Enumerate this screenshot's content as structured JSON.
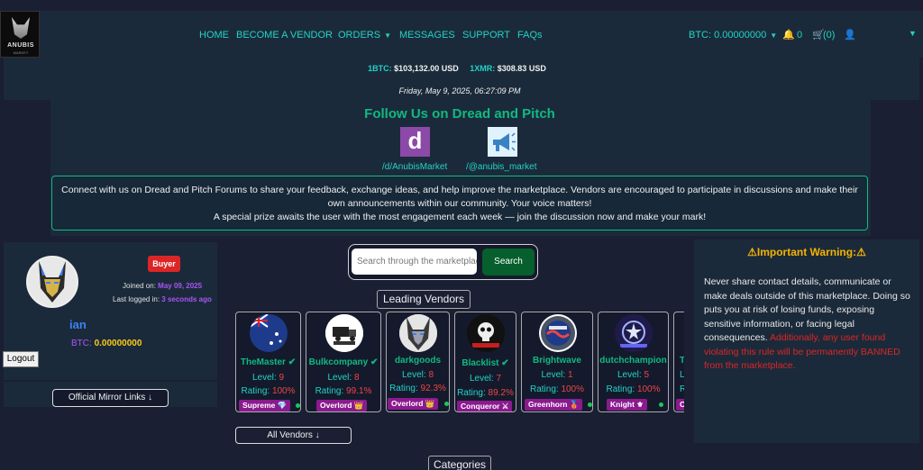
{
  "header": {
    "logo_text": "ANUBIS",
    "logo_subtext": "MARKET",
    "nav": [
      {
        "label": "HOME"
      },
      {
        "label": "BECOME A VENDOR"
      },
      {
        "label": "ORDERS"
      },
      {
        "label": "MESSAGES"
      },
      {
        "label": "SUPPORT"
      },
      {
        "label": "FAQs"
      }
    ],
    "balance": "BTC: 0.00000000",
    "notifications_count": "0",
    "cart_count": "(0)"
  },
  "rates": {
    "btc_label": "1BTC:",
    "btc_value": "$103,132.00 USD",
    "xmr_label": "1XMR:",
    "xmr_value": "$308.83 USD"
  },
  "datetime": "Friday, May 9, 2025, 06:27:09 PM",
  "follow": {
    "title": "Follow Us on Dread and Pitch",
    "dread_link": "/d/AnubisMarket",
    "pitch_link": "/@anubis_market",
    "announcement": [
      "Connect with us on Dread and Pitch Forums to share your feedback, exchange ideas, and help improve the marketplace. Vendors are encouraged to participate in discussions and make their",
      "own announcements within our community. Your voice matters!",
      "A special prize awaits the user with the most engagement each week — join the discussion now and make your mark!"
    ]
  },
  "profile": {
    "role_badge": "Buyer",
    "joined_label": "Joined on:",
    "joined_value": "May 09, 2025",
    "last_login_label": "Last logged in:",
    "last_login_value": "3 seconds ago",
    "username": "ian",
    "btc_label": "BTC:",
    "btc_value": "0.00000000",
    "logout_label": "Logout",
    "mirror_label": "Official Mirror Links  ↓"
  },
  "search": {
    "placeholder": "Search through the marketplace",
    "button_label": "Search"
  },
  "leading_vendors": {
    "title": "Leading Vendors",
    "vendors": [
      {
        "name": "TheMaster ✔",
        "level_label": "Level:",
        "level": "9",
        "rating_label": "Rating:",
        "rating": "100%",
        "badge": "Supreme 💎"
      },
      {
        "name": "Bulkcompany ✔",
        "level_label": "Level:",
        "level": "8",
        "rating_label": "Rating:",
        "rating": "99.1%",
        "badge": "Overlord 👑"
      },
      {
        "name": "darkgoods",
        "level_label": "Level:",
        "level": "8",
        "rating_label": "Rating:",
        "rating": "92.3%",
        "badge": "Overlord 👑"
      },
      {
        "name": "Blacklist ✔",
        "level_label": "Level:",
        "level": "7",
        "rating_label": "Rating:",
        "rating": "89.2%",
        "badge": "Conqueror ⚔"
      },
      {
        "name": "Brightwave",
        "level_label": "Level:",
        "level": "1",
        "rating_label": "Rating:",
        "rating": "100%",
        "badge": "Greenhorn 🥉"
      },
      {
        "name": "dutchchampion",
        "level_label": "Level:",
        "level": "5",
        "rating_label": "Rating:",
        "rating": "100%",
        "badge": "Knight ⚜"
      },
      {
        "name": "T",
        "level_label": "L",
        "level": "",
        "rating_label": "R",
        "rating": "",
        "badge": "C"
      }
    ],
    "all_vendors_label": "All Vendors  ↓"
  },
  "categories_label": "Categories",
  "warning": {
    "title": "⚠Important Warning:⚠",
    "body": "Never share contact details, communicate or make deals outside of this marketplace. Doing so puts you at risk of losing funds, exposing sensitive information, or facing legal consequences.",
    "body_red": "Additionally, any user found violating this rule will be permanently BANNED from the marketplace."
  },
  "colors": {
    "accent_teal": "#22d3c5",
    "accent_green": "#10b981",
    "danger": "#dc2626",
    "badge_purple": "#8b1a8f",
    "background": "#1a1f33",
    "panel": "#1b2a3a"
  }
}
